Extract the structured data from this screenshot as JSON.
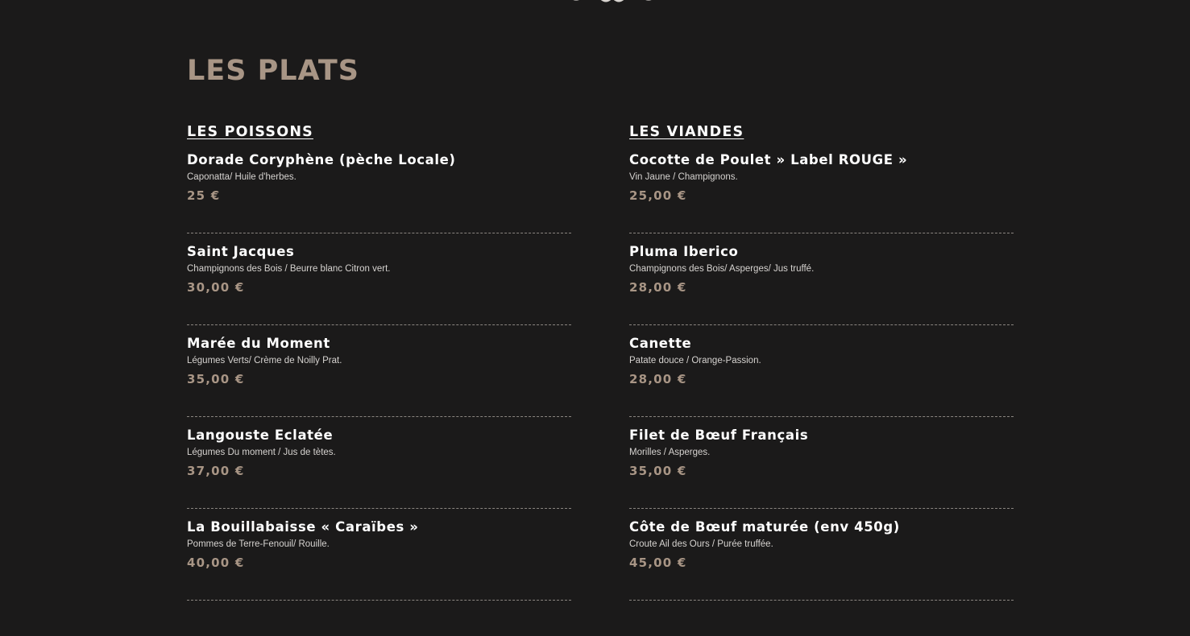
{
  "section_title": "LES PLATS",
  "columns": [
    {
      "heading": "LES POISSONS",
      "dishes": [
        {
          "name": "Dorade Coryphène (pèche Locale)",
          "desc": "Caponatta/ Huile d'herbes.",
          "price": "25 €"
        },
        {
          "name": "Saint Jacques",
          "desc": "Champignons des Bois / Beurre blanc Citron vert.",
          "price": "30,00 €"
        },
        {
          "name": "Marée du Moment",
          "desc": "Légumes Verts/ Crème de Noilly Prat.",
          "price": "35,00 €"
        },
        {
          "name": "Langouste Eclatée",
          "desc": "Légumes Du moment / Jus de tètes.",
          "price": "37,00 €"
        },
        {
          "name": "La Bouillabaisse « Caraïbes »",
          "desc": "Pommes de Terre-Fenouil/ Rouille.",
          "price": "40,00 €"
        }
      ]
    },
    {
      "heading": "LES VIANDES",
      "dishes": [
        {
          "name": "Cocotte de Poulet » Label ROUGE »",
          "desc": "Vin Jaune / Champignons.",
          "price": "25,00 €"
        },
        {
          "name": "Pluma Iberico",
          "desc": "Champignons des Bois/ Asperges/ Jus truffé.",
          "price": "28,00 €"
        },
        {
          "name": "Canette",
          "desc": "Patate douce / Orange-Passion.",
          "price": "28,00 €"
        },
        {
          "name": "Filet de Bœuf Français",
          "desc": "Morilles / Asperges.",
          "price": "35,00 €"
        },
        {
          "name": "Côte de Bœuf maturée (env 450g)",
          "desc": "Croute Ail des Ours / Purée truffée.",
          "price": "45,00 €"
        }
      ]
    }
  ],
  "ornament_icon": "decorative-flourish-icon",
  "colors": {
    "background": "#1b1a1a",
    "accent": "#a89585",
    "text": "#ffffff"
  }
}
